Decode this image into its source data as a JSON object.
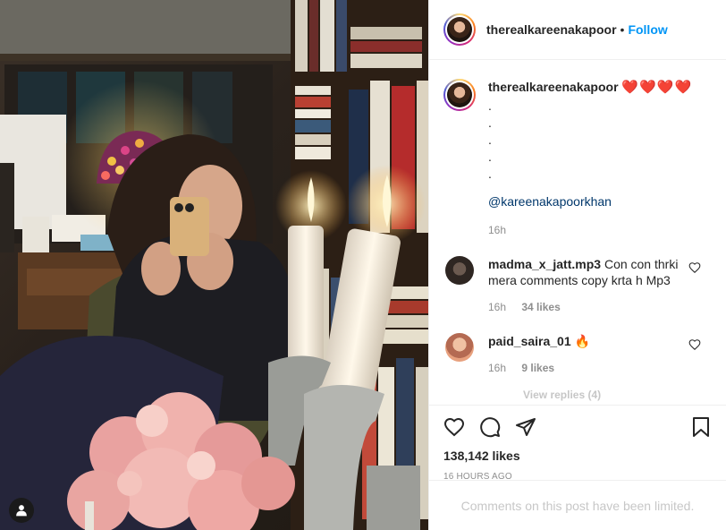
{
  "header": {
    "username": "therealkareenakapoor",
    "separator": "•",
    "follow_label": "Follow"
  },
  "caption": {
    "username": "therealkareenakapoor",
    "text": "❤️❤️❤️❤️",
    "dots": [
      ".",
      ".",
      ".",
      ".",
      "."
    ],
    "mention": "@kareenakapoorkhan",
    "time": "16h"
  },
  "comments": [
    {
      "username": "madma_x_jatt.mp3",
      "text": "Con con thrki mera comments copy krta h Mp3",
      "time": "16h",
      "likes": "34 likes"
    },
    {
      "username": "paid_saira_01",
      "text": "🔥",
      "time": "16h",
      "likes": "9 likes"
    }
  ],
  "view_replies": "View replies (4)",
  "post": {
    "likes": "138,142 likes",
    "posted": "16 HOURS AGO",
    "comments_limited": "Comments on this post have been limited."
  },
  "icons": {
    "like": "heart-outline-icon",
    "comment": "comment-bubble-icon",
    "share": "paper-plane-icon",
    "save": "bookmark-icon",
    "user_tag": "user-icon"
  },
  "colors": {
    "link": "#0095f6",
    "mention": "#00376b",
    "muted": "#8e8e8e",
    "heart": "#e0202a"
  }
}
